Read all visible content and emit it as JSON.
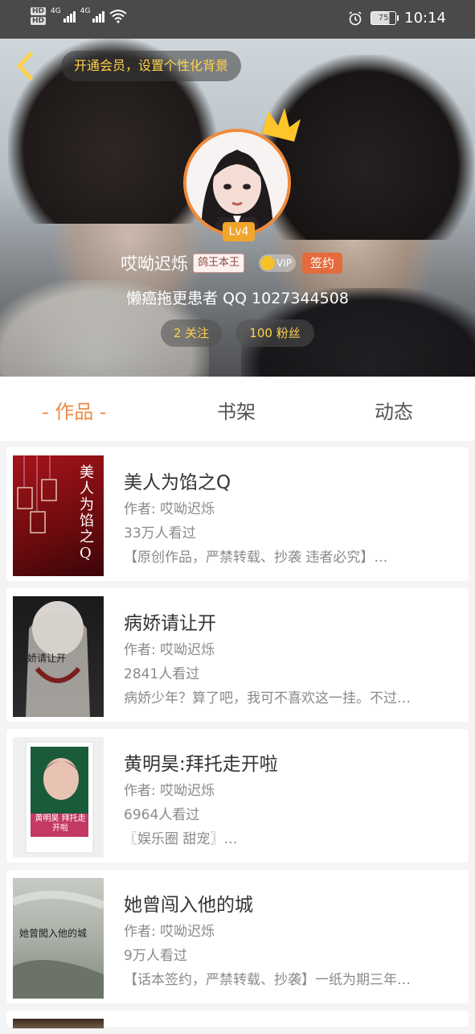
{
  "statusbar": {
    "time": "10:14",
    "battery": "75",
    "network_1": "4G",
    "network_2": "4G",
    "hd_1": "HD",
    "hd_2": "HD"
  },
  "header": {
    "vip_background_text": "开通会员，设置个性化背景",
    "username": "哎呦迟烁",
    "title_badge": "鸽王本王",
    "vip_label": "VIP",
    "sign_label": "签约",
    "level": "Lv4",
    "bio": "懒癌拖更患者 QQ 1027344508",
    "follow_text": "2 关注",
    "fans_text": "100 粉丝"
  },
  "tabs": {
    "works": "- 作品 -",
    "shelf": "书架",
    "news": "动态"
  },
  "books": [
    {
      "title": "美人为馅之Q",
      "author": "作者: 哎呦迟烁",
      "views": "33万人看过",
      "desc": "【原创作品，严禁转载、抄袭  违者必究】…",
      "cover_text": "美人为馅之Q"
    },
    {
      "title": "病娇请让开",
      "author": "作者: 哎呦迟烁",
      "views": "2841人看过",
      "desc": "病娇少年？算了吧，我可不喜欢这一挂。不过…",
      "cover_text": "病娇请让开"
    },
    {
      "title": "黄明昊:拜托走开啦",
      "author": "作者: 哎呦迟烁",
      "views": "6964人看过",
      "desc": "〖娱乐圈   甜宠〗…",
      "cover_text": "黄明昊 拜托走开啦"
    },
    {
      "title": "她曾闯入他的城",
      "author": "作者: 哎呦迟烁",
      "views": "9万人看过",
      "desc": "【话本签约，严禁转载、抄袭】一纸为期三年…",
      "cover_text": "她曾闖入他的城"
    }
  ],
  "colors": {
    "accent": "#ee8a48",
    "gold": "#ffd24a",
    "sign": "#e56a3c",
    "level": "#f0a52b"
  }
}
